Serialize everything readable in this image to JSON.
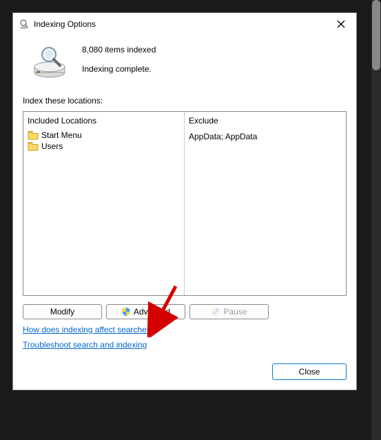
{
  "dialog": {
    "title": "Indexing Options",
    "status": {
      "count_text": "8,080 items indexed",
      "state_text": "Indexing complete."
    },
    "locations_label": "Index these locations:",
    "columns": {
      "included": "Included Locations",
      "exclude": "Exclude"
    },
    "included_items": [
      {
        "label": "Start Menu",
        "exclude": ""
      },
      {
        "label": "Users",
        "exclude": "AppData; AppData"
      }
    ],
    "buttons": {
      "modify": "Modify",
      "advanced": "Advanced",
      "pause": "Pause",
      "close": "Close"
    },
    "links": {
      "how_affect": "How does indexing affect searches?",
      "troubleshoot": "Troubleshoot search and indexing"
    }
  },
  "annotation": {
    "arrow_color": "#d40000"
  }
}
